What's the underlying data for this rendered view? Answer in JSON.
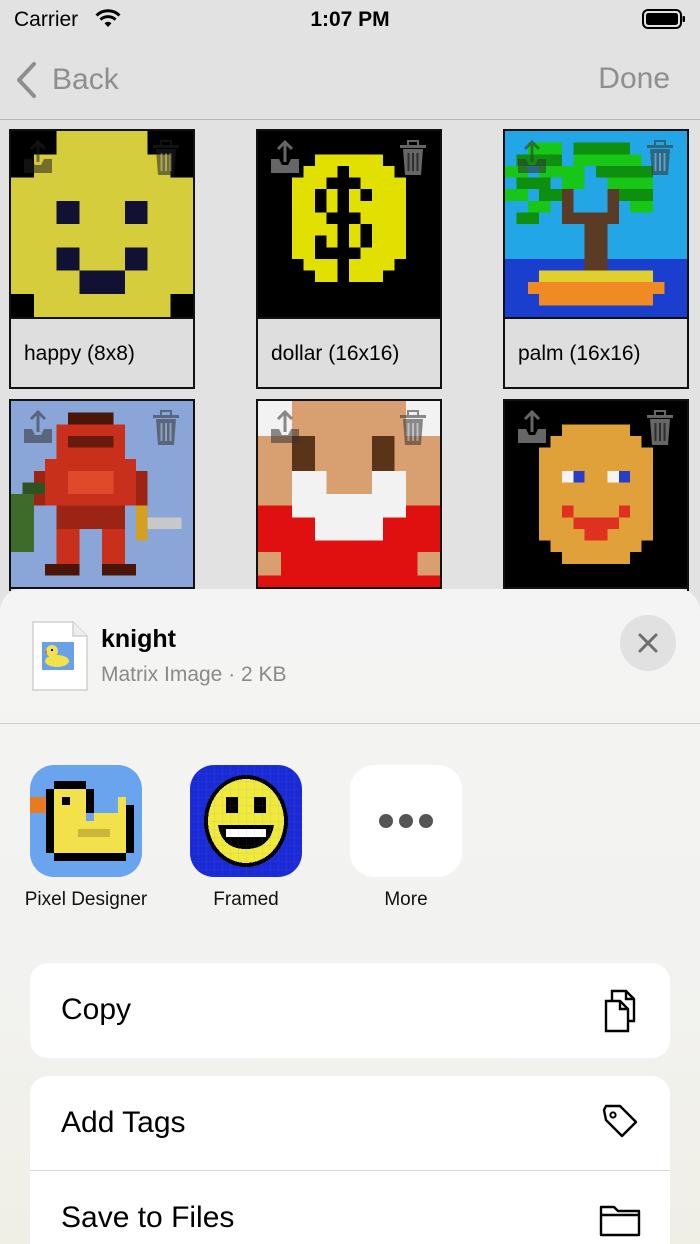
{
  "status": {
    "carrier": "Carrier",
    "time": "1:07 PM"
  },
  "nav": {
    "back_label": "Back",
    "done_label": "Done"
  },
  "grid": {
    "items": [
      {
        "label": "happy (8x8)"
      },
      {
        "label": "dollar (16x16)"
      },
      {
        "label": "palm (16x16)"
      },
      {
        "label": ""
      },
      {
        "label": ""
      },
      {
        "label": ""
      }
    ]
  },
  "sheet": {
    "file_name": "knight",
    "file_meta": "Matrix Image · 2 KB",
    "apps": [
      {
        "label": "Pixel Designer",
        "icon": "duck-app-icon"
      },
      {
        "label": "Framed",
        "icon": "smiley-app-icon"
      },
      {
        "label": "More",
        "icon": "more-icon"
      }
    ],
    "actions": [
      {
        "label": "Copy",
        "icon": "copy-icon"
      },
      {
        "label": "Add Tags",
        "icon": "tag-icon"
      },
      {
        "label": "Save to Files",
        "icon": "folder-icon"
      }
    ]
  },
  "colors": {
    "accent_gray": "#8e8e8e",
    "sheet_bg": "#f4f4f4",
    "card_bg": "#ffffff"
  }
}
